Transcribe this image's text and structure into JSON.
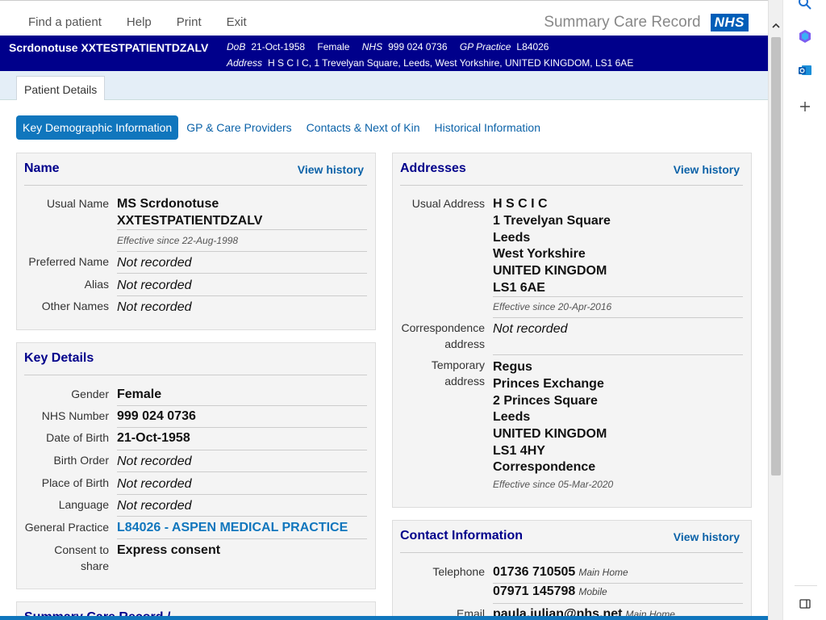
{
  "topbar": {
    "menu": [
      "Find a patient",
      "Help",
      "Print",
      "Exit"
    ],
    "app_title": "Summary Care Record",
    "nhs_logo": "NHS"
  },
  "banner": {
    "patient_name": "Scrdonotuse XXTESTPATIENTDZALV",
    "dob_label": "DoB",
    "dob": "21-Oct-1958",
    "gender": "Female",
    "nhs_label": "NHS",
    "nhs_number": "999 024 0736",
    "gp_label": "GP Practice",
    "gp_code": "L84026",
    "address_label": "Address",
    "address": "H S C I C, 1 Trevelyan Square, Leeds, West Yorkshire, UNITED KINGDOM, LS1 6AE"
  },
  "tabs": {
    "patient_details": "Patient Details"
  },
  "subnav": [
    "Key Demographic Information",
    "GP & Care Providers",
    "Contacts & Next of Kin",
    "Historical Information"
  ],
  "name_panel": {
    "title": "Name",
    "view_history": "View history",
    "usual_name_label": "Usual Name",
    "usual_name_line1": "MS Scrdonotuse",
    "usual_name_line2": "XXTESTPATIENTDZALV",
    "usual_name_effective": "Effective since 22-Aug-1998",
    "preferred_label": "Preferred Name",
    "preferred_value": "Not recorded",
    "alias_label": "Alias",
    "alias_value": "Not recorded",
    "other_label": "Other Names",
    "other_value": "Not recorded"
  },
  "key_details": {
    "title": "Key Details",
    "gender_label": "Gender",
    "gender": "Female",
    "nhs_label": "NHS Number",
    "nhs_number": "999 024 0736",
    "dob_label": "Date of Birth",
    "dob": "21-Oct-1958",
    "birth_order_label": "Birth Order",
    "birth_order": "Not recorded",
    "pob_label": "Place of Birth",
    "pob": "Not recorded",
    "language_label": "Language",
    "language": "Not recorded",
    "gp_label": "General Practice",
    "gp": "L84026 - ASPEN MEDICAL PRACTICE",
    "consent_label_1": "Consent to",
    "consent_label_2": "share",
    "consent": "Express consent"
  },
  "summary_panel": {
    "title_partial": "Summary Care Record /"
  },
  "addresses": {
    "title": "Addresses",
    "view_history": "View history",
    "usual_label": "Usual Address",
    "usual_lines": [
      "H S C I C",
      "1 Trevelyan Square",
      "Leeds",
      "West Yorkshire",
      "UNITED KINGDOM",
      "LS1 6AE"
    ],
    "usual_effective": "Effective since 20-Apr-2016",
    "corr_label_1": "Correspondence",
    "corr_label_2": "address",
    "corr_value": "Not recorded",
    "temp_label_1": "Temporary",
    "temp_label_2": "address",
    "temp_lines": [
      "Regus",
      "Princes Exchange",
      "2 Princes Square",
      "Leeds",
      "UNITED KINGDOM",
      "LS1 4HY",
      "Correspondence"
    ],
    "temp_effective": "Effective since 05-Mar-2020"
  },
  "contact": {
    "title": "Contact Information",
    "view_history": "View history",
    "telephone_label": "Telephone",
    "phone1": "01736 710505",
    "phone1_type": "Main Home",
    "phone2": "07971 145798",
    "phone2_type": "Mobile",
    "email_label": "Email",
    "email_partial": "paula.julian@nhs.net",
    "email_type": "Main Home"
  },
  "icons": {
    "search": "search-icon",
    "copilot": "copilot-icon",
    "outlook": "outlook-icon",
    "add": "plus-icon",
    "sidebar": "sidebar-toggle-icon"
  },
  "colors": {
    "banner": "#00008b",
    "accent": "#1076bd",
    "nhs_blue": "#005eb8"
  }
}
